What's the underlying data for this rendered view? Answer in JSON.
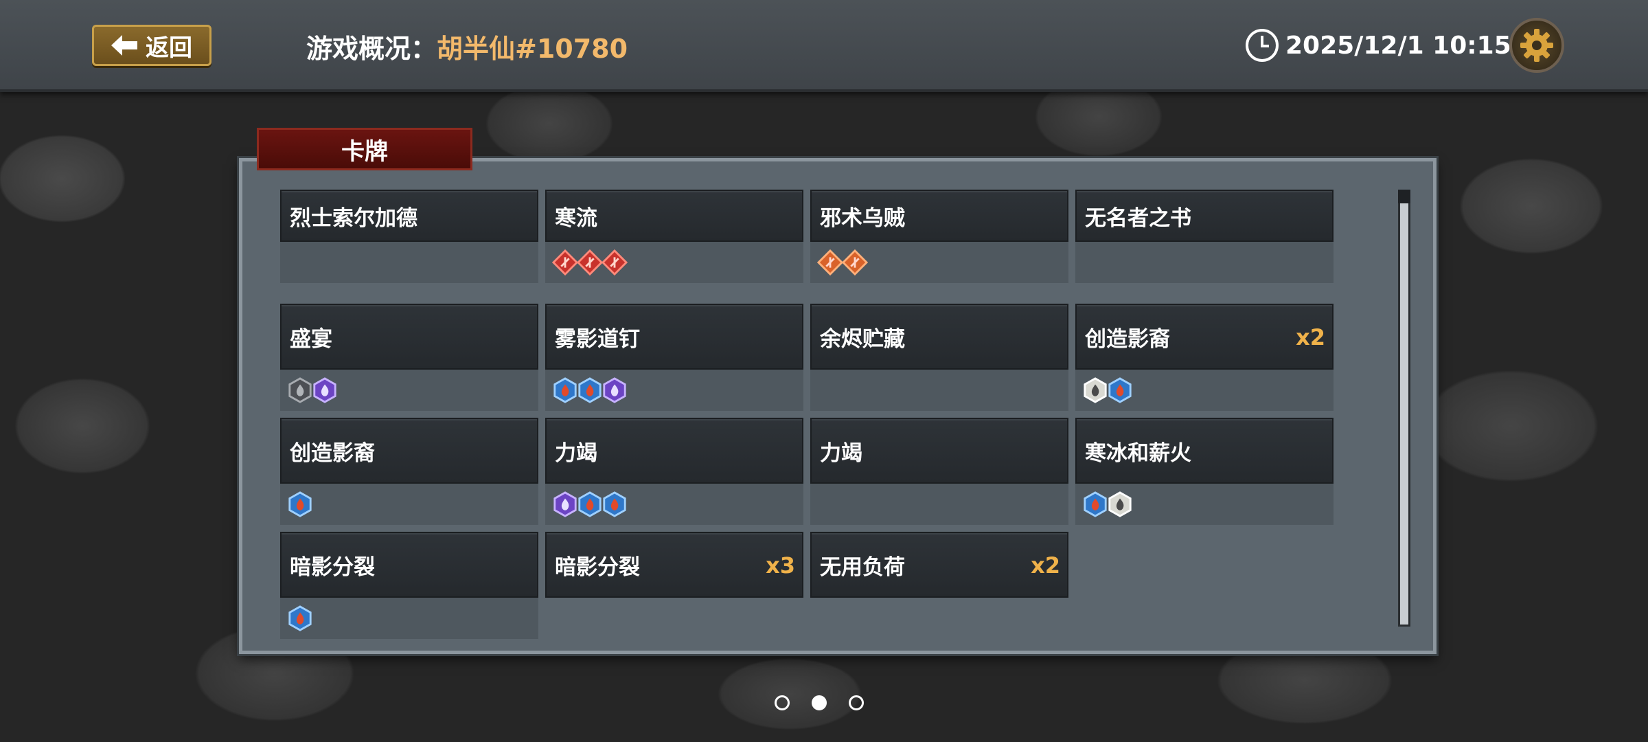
{
  "header": {
    "back_label": "返回",
    "title_label": "游戏概况：",
    "player_name": "胡半仙#10780",
    "datetime": "2025/12/1 10:15"
  },
  "panel": {
    "tab_label": "卡牌"
  },
  "cards": [
    {
      "name": "烈士索尔加德",
      "count": "",
      "icons": []
    },
    {
      "name": "寒流",
      "count": "",
      "icons": [
        "red-diamond",
        "red-diamond",
        "red-diamond"
      ]
    },
    {
      "name": "邪术乌贼",
      "count": "",
      "icons": [
        "orange-diamond",
        "orange-diamond"
      ]
    },
    {
      "name": "无名者之书",
      "count": "",
      "icons": []
    },
    {
      "name": "盛宴",
      "count": "",
      "icons": [
        "gray-hex",
        "purple-hex"
      ]
    },
    {
      "name": "雾影道钉",
      "count": "",
      "icons": [
        "blue-hex",
        "blue-hex",
        "purple-hex"
      ]
    },
    {
      "name": "余烬贮藏",
      "count": "",
      "icons": []
    },
    {
      "name": "创造影裔",
      "count": "x2",
      "icons": [
        "white-hex",
        "blue-hex"
      ]
    },
    {
      "name": "创造影裔",
      "count": "",
      "icons": [
        "blue-hex"
      ]
    },
    {
      "name": "力竭",
      "count": "",
      "icons": [
        "purple-hex",
        "blue-hex",
        "blue-hex"
      ]
    },
    {
      "name": "力竭",
      "count": "",
      "icons": []
    },
    {
      "name": "寒冰和薪火",
      "count": "",
      "icons": [
        "blue-hex",
        "white-hex"
      ]
    },
    {
      "name": "暗影分裂",
      "count": "",
      "icons": [
        "blue-hex"
      ]
    },
    {
      "name": "暗影分裂",
      "count": "x3",
      "icons": []
    },
    {
      "name": "无用负荷",
      "count": "x2",
      "icons": []
    }
  ],
  "pager": {
    "pages": 3,
    "active": 2
  },
  "colors": {
    "accent_gold": "#f0b24a",
    "player_name": "#f3b96b",
    "tab_red": "#6a1410"
  }
}
